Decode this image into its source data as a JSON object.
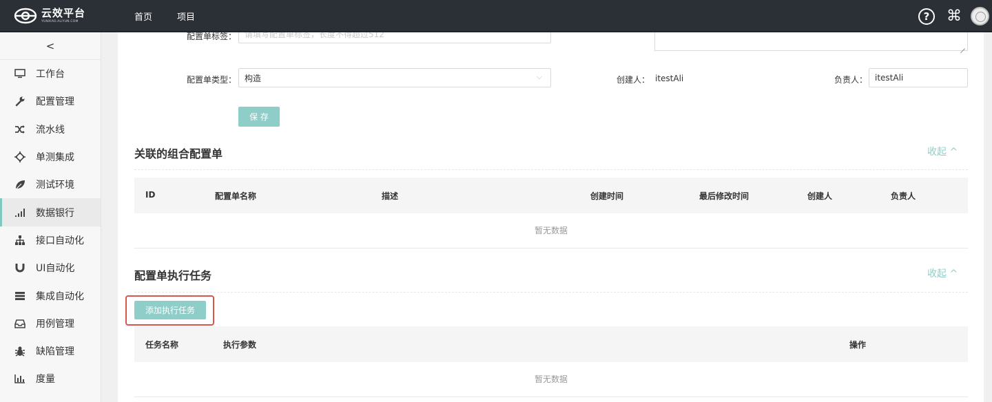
{
  "app": {
    "logo_text": "云效平台",
    "logo_sub": "YUNXIAO.ALIYUN.COM",
    "nav": [
      "首页",
      "项目"
    ],
    "icons": [
      "help-icon",
      "command-icon",
      "avatar"
    ]
  },
  "sidebar": {
    "collapse_label": "<",
    "active_index": 5,
    "items": [
      {
        "label": "工作台",
        "icon": "monitor-icon"
      },
      {
        "label": "配置管理",
        "icon": "wrench-icon"
      },
      {
        "label": "流水线",
        "icon": "shuffle-icon"
      },
      {
        "label": "单测集成",
        "icon": "crosshair-icon"
      },
      {
        "label": "测试环境",
        "icon": "leaf-icon"
      },
      {
        "label": "数据银行",
        "icon": "signal-bars-icon"
      },
      {
        "label": "接口自动化",
        "icon": "sitemap-icon"
      },
      {
        "label": "UI自动化",
        "icon": "magnet-icon"
      },
      {
        "label": "集成自动化",
        "icon": "server-icon"
      },
      {
        "label": "用例管理",
        "icon": "inbox-icon"
      },
      {
        "label": "缺陷管理",
        "icon": "bug-icon"
      },
      {
        "label": "度量",
        "icon": "bar-chart-icon"
      }
    ]
  },
  "form": {
    "tag_label": "配置单标签：",
    "tag_placeholder": "请填写配置单标签，长度不得超过512",
    "type_label": "配置单类型：",
    "type_value": "构造",
    "creator_label": "创建人：",
    "creator_value": "itestAli",
    "owner_label": "负责人：",
    "owner_value": "itestAli",
    "save_label": "保 存"
  },
  "related_section": {
    "title": "关联的组合配置单",
    "collapse_label": "收起 ^",
    "columns": [
      "ID",
      "配置单名称",
      "描述",
      "创建时间",
      "最后修改时间",
      "创建人",
      "负责人"
    ],
    "empty_text": "暂无数据"
  },
  "task_section": {
    "title": "配置单执行任务",
    "collapse_label": "收起 ^",
    "add_button": "添加执行任务",
    "columns": [
      "任务名称",
      "执行参数",
      "操作"
    ],
    "empty_text": "暂无数据"
  },
  "colors": {
    "accent": "#8fcec8",
    "topbar": "#2b2f36",
    "highlight": "#d9534f"
  }
}
